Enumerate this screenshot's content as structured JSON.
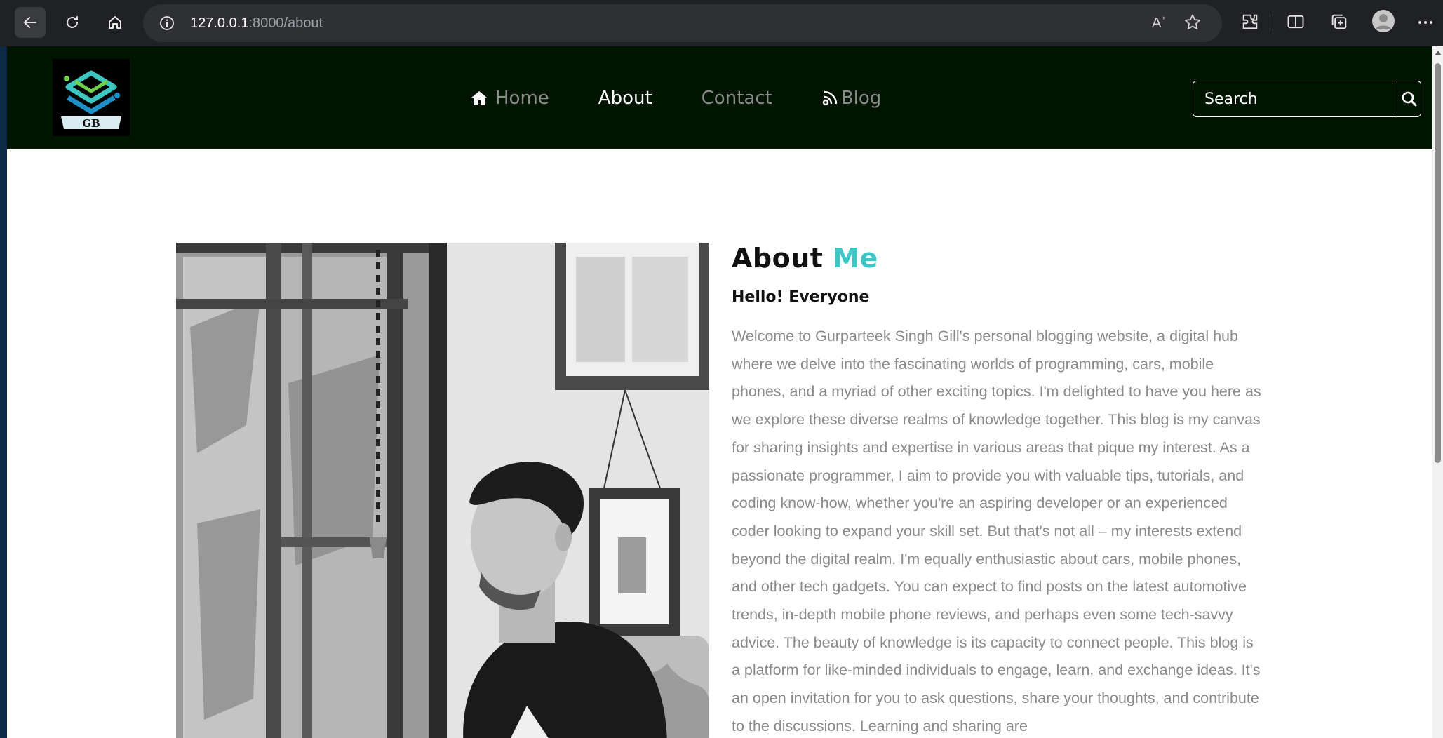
{
  "browser": {
    "url_host": "127.0.0.1",
    "url_path": ":8000/about",
    "read_aloud_label": "Aʾ"
  },
  "site": {
    "logo_text": "GB",
    "nav": {
      "home": "Home",
      "about": "About",
      "contact": "Contact",
      "blog": "Blog"
    },
    "search": {
      "placeholder": "Search"
    }
  },
  "about": {
    "title_part1": "About",
    "title_part2": "Me",
    "greeting": "Hello! Everyone",
    "paragraph": "Welcome to Gurparteek Singh Gill's personal blogging website, a digital hub where we delve into the fascinating worlds of programming, cars, mobile phones, and a myriad of other exciting topics. I'm delighted to have you here as we explore these diverse realms of knowledge together. This blog is my canvas for sharing insights and expertise in various areas that pique my interest. As a passionate programmer, I aim to provide you with valuable tips, tutorials, and coding know-how, whether you're an aspiring developer or an experienced coder looking to expand your skill set. But that's not all – my interests extend beyond the digital realm. I'm equally enthusiastic about cars, mobile phones, and other tech gadgets. You can expect to find posts on the latest automotive trends, in-depth mobile phone reviews, and perhaps even some tech-savvy advice. The beauty of knowledge is its capacity to connect people. This blog is a platform for like-minded individuals to engage, learn, and exchange ideas. It's an open invitation for you to ask questions, share your thoughts, and contribute to the discussions. Learning and sharing are"
  },
  "colors": {
    "nav_bg": "#001500",
    "accent": "#3cc6c6",
    "body_text": "#8a8a8a"
  }
}
